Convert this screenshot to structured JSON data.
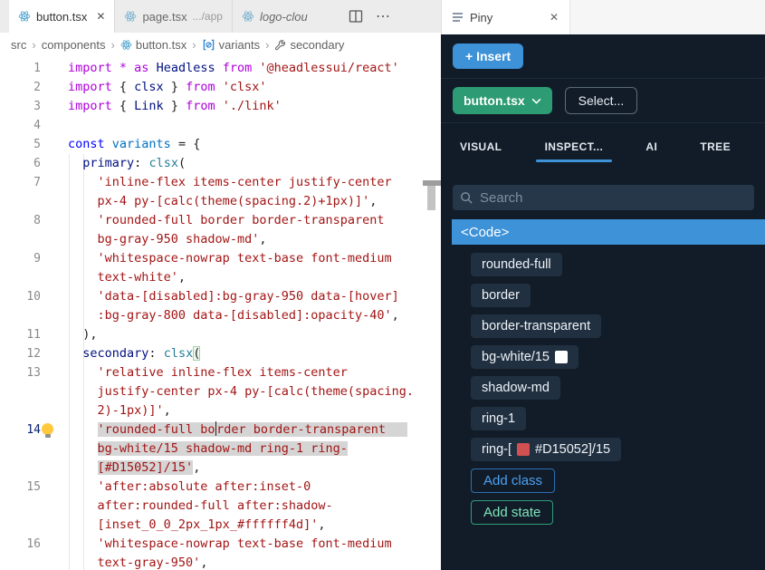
{
  "colors": {
    "accent_blue": "#3D92D8",
    "accent_green": "#2D9B74",
    "swatch_white": "#FFFFFF",
    "swatch_red": "#D15052"
  },
  "icons": {
    "close": "✕",
    "more": "⋯"
  },
  "editor": {
    "tabs": {
      "tab1": "button.tsx",
      "tab2": "page.tsx",
      "tab2_suffix": ".../app",
      "tab3": "logo-clou"
    },
    "breadcrumb": {
      "src": "src",
      "components": "components",
      "file": "button.tsx",
      "variants": "variants",
      "secondary": "secondary"
    },
    "lines": [
      {
        "num": "1",
        "parts": [
          {
            "t": "import ",
            "c": "kw"
          },
          {
            "t": "* ",
            "c": "kw"
          },
          {
            "t": "as ",
            "c": "kw"
          },
          {
            "t": "Headless ",
            "c": "id"
          },
          {
            "t": "from ",
            "c": "kw"
          },
          {
            "t": "'@headlessui/react'",
            "c": "st"
          }
        ]
      },
      {
        "num": "2",
        "parts": [
          {
            "t": "import ",
            "c": "kw"
          },
          {
            "t": "{ ",
            "c": "pn"
          },
          {
            "t": "clsx",
            "c": "id"
          },
          {
            "t": " } ",
            "c": "pn"
          },
          {
            "t": "from ",
            "c": "kw"
          },
          {
            "t": "'clsx'",
            "c": "st"
          }
        ]
      },
      {
        "num": "3",
        "parts": [
          {
            "t": "import ",
            "c": "kw"
          },
          {
            "t": "{ ",
            "c": "pn"
          },
          {
            "t": "Link",
            "c": "id"
          },
          {
            "t": " } ",
            "c": "pn"
          },
          {
            "t": "from ",
            "c": "kw"
          },
          {
            "t": "'./link'",
            "c": "st"
          }
        ]
      },
      {
        "num": "4",
        "parts": []
      },
      {
        "num": "5",
        "parts": [
          {
            "t": "const ",
            "c": "ckw"
          },
          {
            "t": "variants",
            "c": "var"
          },
          {
            "t": " = {",
            "c": "pn"
          }
        ]
      },
      {
        "num": "6",
        "parts": [
          {
            "t": "  ",
            "c": "pn"
          },
          {
            "t": "primary",
            "c": "id"
          },
          {
            "t": ": ",
            "c": "pn"
          },
          {
            "t": "clsx",
            "c": "fn"
          },
          {
            "t": "(",
            "c": "pn"
          }
        ]
      },
      {
        "num": "7",
        "parts": [
          {
            "t": "    ",
            "c": "pn"
          },
          {
            "t": "'inline-flex items-center justify-center",
            "c": "st"
          }
        ]
      },
      {
        "num": "",
        "parts": [
          {
            "t": "    ",
            "c": "pn"
          },
          {
            "t": "px-4 py-[calc(theme(spacing.2)+1px)]'",
            "c": "st"
          },
          {
            "t": ",",
            "c": "pn"
          }
        ]
      },
      {
        "num": "8",
        "parts": [
          {
            "t": "    ",
            "c": "pn"
          },
          {
            "t": "'rounded-full border border-transparent",
            "c": "st"
          }
        ]
      },
      {
        "num": "",
        "parts": [
          {
            "t": "    ",
            "c": "pn"
          },
          {
            "t": "bg-gray-950 shadow-md'",
            "c": "st"
          },
          {
            "t": ",",
            "c": "pn"
          }
        ]
      },
      {
        "num": "9",
        "parts": [
          {
            "t": "    ",
            "c": "pn"
          },
          {
            "t": "'whitespace-nowrap text-base font-medium",
            "c": "st"
          }
        ]
      },
      {
        "num": "",
        "parts": [
          {
            "t": "    ",
            "c": "pn"
          },
          {
            "t": "text-white'",
            "c": "st"
          },
          {
            "t": ",",
            "c": "pn"
          }
        ]
      },
      {
        "num": "10",
        "parts": [
          {
            "t": "    ",
            "c": "pn"
          },
          {
            "t": "'data-[disabled]:bg-gray-950 data-[hover]",
            "c": "st"
          }
        ]
      },
      {
        "num": "",
        "parts": [
          {
            "t": "    ",
            "c": "pn"
          },
          {
            "t": ":bg-gray-800 data-[disabled]:opacity-40'",
            "c": "st"
          },
          {
            "t": ",",
            "c": "pn"
          }
        ]
      },
      {
        "num": "11",
        "parts": [
          {
            "t": "  ),",
            "c": "pn"
          }
        ]
      },
      {
        "num": "12",
        "parts": [
          {
            "t": "  ",
            "c": "pn"
          },
          {
            "t": "secondary",
            "c": "id"
          },
          {
            "t": ": ",
            "c": "pn"
          },
          {
            "t": "clsx",
            "c": "fn"
          },
          {
            "t": "(",
            "c": "pn",
            "bracket": true
          }
        ]
      },
      {
        "num": "13",
        "parts": [
          {
            "t": "    ",
            "c": "pn"
          },
          {
            "t": "'relative inline-flex items-center",
            "c": "st"
          }
        ]
      },
      {
        "num": "",
        "parts": [
          {
            "t": "    ",
            "c": "pn"
          },
          {
            "t": "justify-center px-4 py-[calc(theme(spacing.",
            "c": "st"
          }
        ]
      },
      {
        "num": "",
        "parts": [
          {
            "t": "    ",
            "c": "pn"
          },
          {
            "t": "2)-1px)]'",
            "c": "st"
          },
          {
            "t": ",",
            "c": "pn"
          }
        ]
      },
      {
        "num": "14",
        "active": true,
        "bulb": true,
        "parts": [
          {
            "t": "    ",
            "c": "pn"
          },
          {
            "t": "'rounded-full bo",
            "c": "st",
            "sel": true
          },
          {
            "caret": true
          },
          {
            "t": "rder border-transparent",
            "c": "st",
            "sel": true
          },
          {
            "t": "   ",
            "c": "pn",
            "sel": true
          }
        ]
      },
      {
        "num": "",
        "parts": [
          {
            "t": "    ",
            "c": "pn"
          },
          {
            "t": "bg-white/15 shadow-md ring-1 ring-",
            "c": "st",
            "sel": true
          }
        ]
      },
      {
        "num": "",
        "parts": [
          {
            "t": "    ",
            "c": "pn"
          },
          {
            "t": "[#D15052]/15'",
            "c": "st",
            "sel": true
          },
          {
            "t": ",",
            "c": "pn"
          }
        ]
      },
      {
        "num": "15",
        "parts": [
          {
            "t": "    ",
            "c": "pn"
          },
          {
            "t": "'after:absolute after:inset-0",
            "c": "st"
          }
        ]
      },
      {
        "num": "",
        "parts": [
          {
            "t": "    ",
            "c": "pn"
          },
          {
            "t": "after:rounded-full after:shadow-",
            "c": "st"
          }
        ]
      },
      {
        "num": "",
        "parts": [
          {
            "t": "    ",
            "c": "pn"
          },
          {
            "t": "[inset_0_0_2px_1px_#ffffff4d]'",
            "c": "st"
          },
          {
            "t": ",",
            "c": "pn"
          }
        ]
      },
      {
        "num": "16",
        "parts": [
          {
            "t": "    ",
            "c": "pn"
          },
          {
            "t": "'whitespace-nowrap text-base font-medium",
            "c": "st"
          }
        ]
      },
      {
        "num": "",
        "parts": [
          {
            "t": "    ",
            "c": "pn"
          },
          {
            "t": "text-gray-950'",
            "c": "st"
          },
          {
            "t": ",",
            "c": "pn"
          }
        ]
      }
    ]
  },
  "panel": {
    "tab_title": "Piny",
    "insert_label": "+ Insert",
    "file_button": "button.tsx",
    "select_button": "Select...",
    "tabs": [
      "VISUAL",
      "INSPECT...",
      "AI",
      "TREE"
    ],
    "active_tab": 1,
    "search_placeholder": "Search",
    "code_header": "<Code>",
    "chips": [
      {
        "parts": [
          {
            "t": "rounded-full"
          }
        ]
      },
      {
        "parts": [
          {
            "t": "border"
          }
        ]
      },
      {
        "parts": [
          {
            "t": "border-transparent"
          }
        ]
      },
      {
        "parts": [
          {
            "t": "bg-white/15"
          },
          {
            "swatch": "#FFFFFF"
          }
        ]
      },
      {
        "parts": [
          {
            "t": "shadow-md"
          }
        ]
      },
      {
        "parts": [
          {
            "t": "ring-1"
          }
        ]
      },
      {
        "parts": [
          {
            "t": "ring-["
          },
          {
            "swatch": "#D15052"
          },
          {
            "t": "#D15052]/15"
          }
        ]
      }
    ],
    "add_class": "Add class",
    "add_state": "Add state"
  }
}
